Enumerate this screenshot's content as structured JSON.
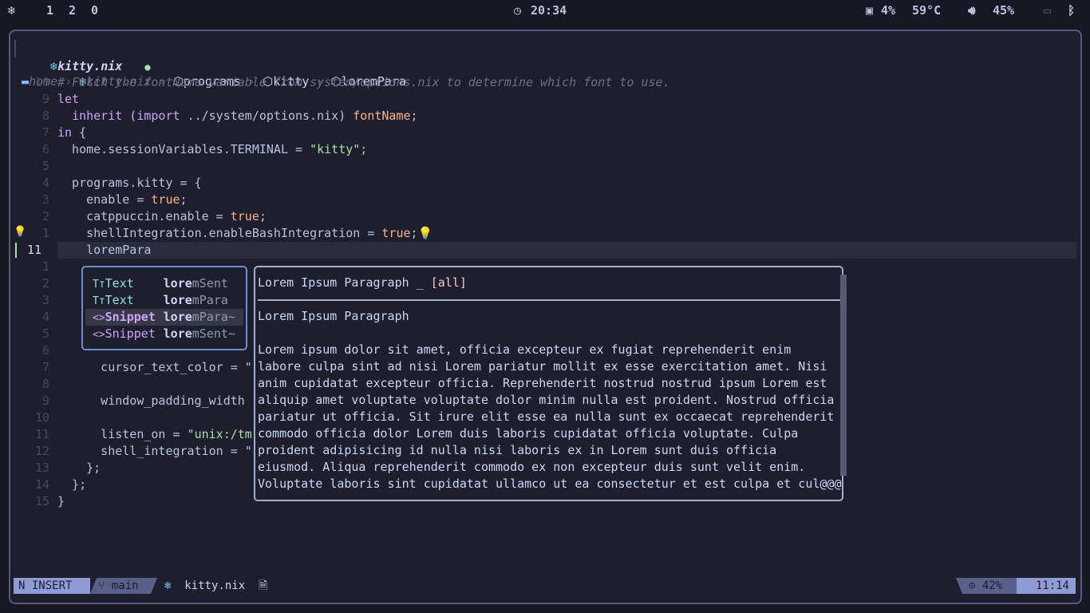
{
  "topbar": {
    "logo_icon": "nix-snowflake-icon",
    "workspaces": [
      "1",
      "2",
      "0"
    ],
    "clock_icon": "clock-icon",
    "time": "20:34",
    "cpu_icon": "cpu-icon",
    "cpu": "4%",
    "temp": "59°C",
    "volume_icon": "speaker-icon",
    "volume": "45%",
    "network_icon": "network-disconnected-icon",
    "bluetooth_icon": "bluetooth-icon"
  },
  "tab": {
    "icon": "nix-snowflake-icon",
    "name": "kitty.nix",
    "modified_dot": "●"
  },
  "breadcrumb": [
    "home",
    "kitty.nix",
    "programs",
    "kitty",
    "loremPara"
  ],
  "lines": [
    {
      "n": "10",
      "code": [
        [
          "c",
          "# Fetch the fontName variable from system/options.nix to determine which font to use."
        ]
      ]
    },
    {
      "n": "9",
      "code": [
        [
          "k",
          "let"
        ]
      ]
    },
    {
      "n": "8",
      "code": [
        [
          "t",
          "  "
        ],
        [
          "k",
          "inherit"
        ],
        [
          "t",
          " ("
        ],
        [
          "k",
          "import"
        ],
        [
          "t",
          " ../system/options.nix) "
        ],
        [
          "b",
          "fontName"
        ],
        [
          "t",
          ";"
        ]
      ]
    },
    {
      "n": "7",
      "code": [
        [
          "k",
          "in"
        ],
        [
          "t",
          " {"
        ]
      ]
    },
    {
      "n": "6",
      "code": [
        [
          "t",
          "  home.sessionVariables.TERMINAL = "
        ],
        [
          "s",
          "\"kitty\""
        ],
        [
          "t",
          ";"
        ]
      ]
    },
    {
      "n": "5",
      "code": []
    },
    {
      "n": "4",
      "code": [
        [
          "t",
          "  programs.kitty = {"
        ]
      ]
    },
    {
      "n": "3",
      "code": [
        [
          "t",
          "    enable = "
        ],
        [
          "b",
          "true"
        ],
        [
          "t",
          ";"
        ]
      ]
    },
    {
      "n": "2",
      "code": [
        [
          "t",
          "    catppuccin.enable = "
        ],
        [
          "b",
          "true"
        ],
        [
          "t",
          ";"
        ]
      ]
    },
    {
      "n": "1",
      "code": [
        [
          "t",
          "    shellIntegration.enableBashIntegration = "
        ],
        [
          "b",
          "true"
        ],
        [
          "t",
          ";💡"
        ]
      ]
    },
    {
      "n": "11",
      "code": [
        [
          "t",
          "    loremPara"
        ]
      ],
      "current": true
    },
    {
      "n": "1",
      "code": []
    },
    {
      "n": "2",
      "code": []
    },
    {
      "n": "3",
      "code": []
    },
    {
      "n": "4",
      "code": []
    },
    {
      "n": "5",
      "code": []
    },
    {
      "n": "6",
      "code": []
    },
    {
      "n": "7",
      "code": [
        [
          "t",
          "      cursor_text_color = \""
        ]
      ]
    },
    {
      "n": "8",
      "code": []
    },
    {
      "n": "9",
      "code": [
        [
          "t",
          "      window_padding_width"
        ]
      ]
    },
    {
      "n": "10",
      "code": []
    },
    {
      "n": "11",
      "code": [
        [
          "t",
          "      listen_on = \""
        ],
        [
          "s",
          "unix:/tm"
        ]
      ]
    },
    {
      "n": "12",
      "code": [
        [
          "t",
          "      shell_integration = \""
        ]
      ]
    },
    {
      "n": "13",
      "code": [
        [
          "t",
          "    };"
        ]
      ]
    },
    {
      "n": "14",
      "code": [
        [
          "t",
          "  };"
        ]
      ]
    },
    {
      "n": "15",
      "code": [
        [
          "t",
          "}"
        ]
      ]
    }
  ],
  "completion": [
    {
      "icon": "Tт",
      "kind": "Text",
      "match": "lore",
      "rest": "mSent"
    },
    {
      "icon": "Tт",
      "kind": "Text",
      "match": "lore",
      "rest": "mPara"
    },
    {
      "icon": "<>",
      "kind": "Snippet",
      "match": "lore",
      "rest": "mPara~",
      "selected": true
    },
    {
      "icon": "<>",
      "kind": "Snippet",
      "match": "lore",
      "rest": "mSent~"
    }
  ],
  "doc": {
    "title": "Lorem Ipsum Paragraph _ ",
    "tag": "[all]",
    "heading": "Lorem Ipsum Paragraph",
    "body": [
      "Lorem ipsum dolor sit amet, officia excepteur ex fugiat reprehenderit enim",
      "labore culpa sint ad nisi Lorem pariatur mollit ex esse exercitation amet. Nisi",
      "anim cupidatat excepteur officia. Reprehenderit nostrud nostrud ipsum Lorem est",
      "aliquip amet voluptate voluptate dolor minim nulla est proident. Nostrud officia",
      "pariatur ut officia. Sit irure elit esse ea nulla sunt ex occaecat reprehenderit",
      "commodo officia dolor Lorem duis laboris cupidatat officia voluptate. Culpa",
      "proident adipisicing id nulla nisi laboris ex in Lorem sunt duis officia",
      "eiusmod. Aliqua reprehenderit commodo ex non excepteur duis sunt velit enim.",
      "Voluptate laboris sint cupidatat ullamco ut ea consectetur et est culpa et cul@@@"
    ]
  },
  "statusline": {
    "mode": "INSERT",
    "branch": "main",
    "file": "kitty.nix",
    "progress": "42%",
    "position": "11:14"
  }
}
